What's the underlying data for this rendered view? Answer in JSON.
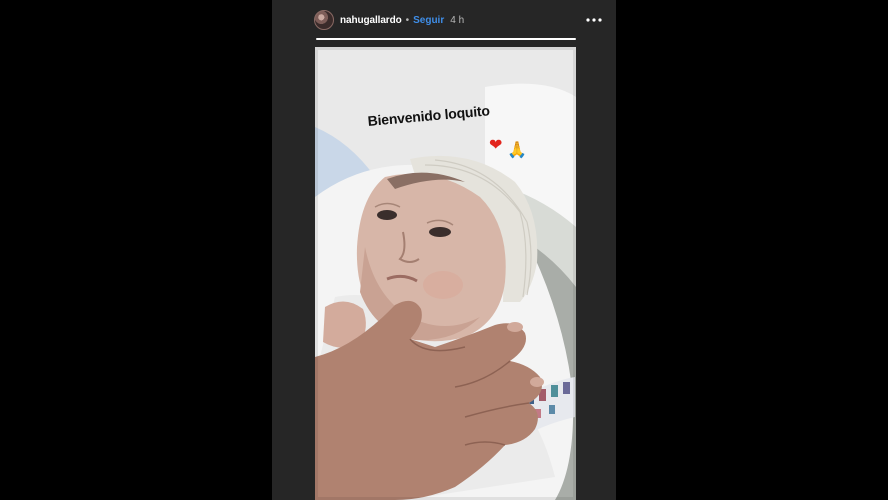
{
  "story": {
    "username": "nahugallardo",
    "separator": "•",
    "follow_label": "Seguir",
    "time_ago": "4 h",
    "more_icon": "more-horizontal-icon",
    "progress": 1.0,
    "caption": "Bienvenido loquito",
    "emoji": {
      "heart": "❤",
      "pray": "🙏"
    }
  },
  "colors": {
    "background": "#000000",
    "panel": "#262626",
    "follow": "#3f8ee8"
  }
}
